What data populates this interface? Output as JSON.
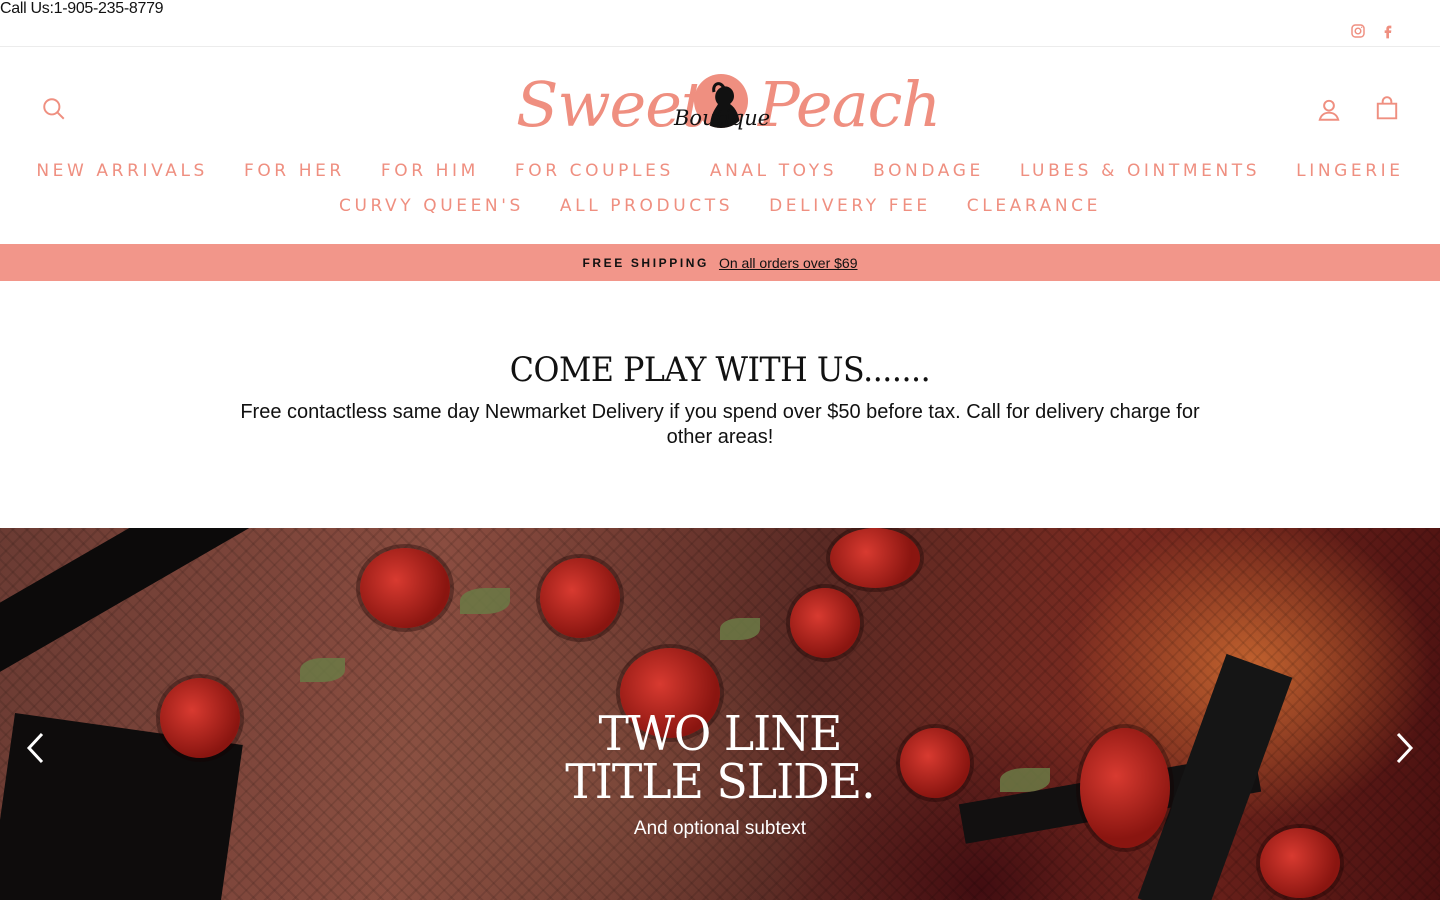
{
  "topbar": {
    "call": "Call Us:1-905-235-8779",
    "social": [
      "instagram-icon",
      "facebook-icon"
    ]
  },
  "header": {
    "logo": {
      "word_left": "Sweet",
      "word_right": "Peach",
      "sub": "Boutique"
    },
    "icons": [
      "search-icon",
      "user-icon",
      "cart-icon"
    ]
  },
  "nav": {
    "row1": [
      "NEW ARRIVALS",
      "FOR HER",
      "FOR HIM",
      "FOR COUPLES",
      "ANAL TOYS",
      "BONDAGE",
      "LUBES & OINTMENTS",
      "LINGERIE"
    ],
    "row2": [
      "CURVY QUEEN'S",
      "ALL PRODUCTS",
      "DELIVERY FEE",
      "CLEARANCE"
    ]
  },
  "announcement": {
    "strong": "FREE SHIPPING",
    "link": "On all orders over $69"
  },
  "intro": {
    "title": "COME PLAY WITH US.......",
    "text": "Free contactless same day Newmarket Delivery if you spend over $50 before tax. Call for delivery charge for other areas!"
  },
  "hero": {
    "title_line1": "TWO LINE",
    "title_line2": "TITLE SLIDE.",
    "subtext": "And optional subtext"
  },
  "colors": {
    "accent": "#ef8f80",
    "announce_bg": "#f2968a",
    "text": "#111111"
  }
}
